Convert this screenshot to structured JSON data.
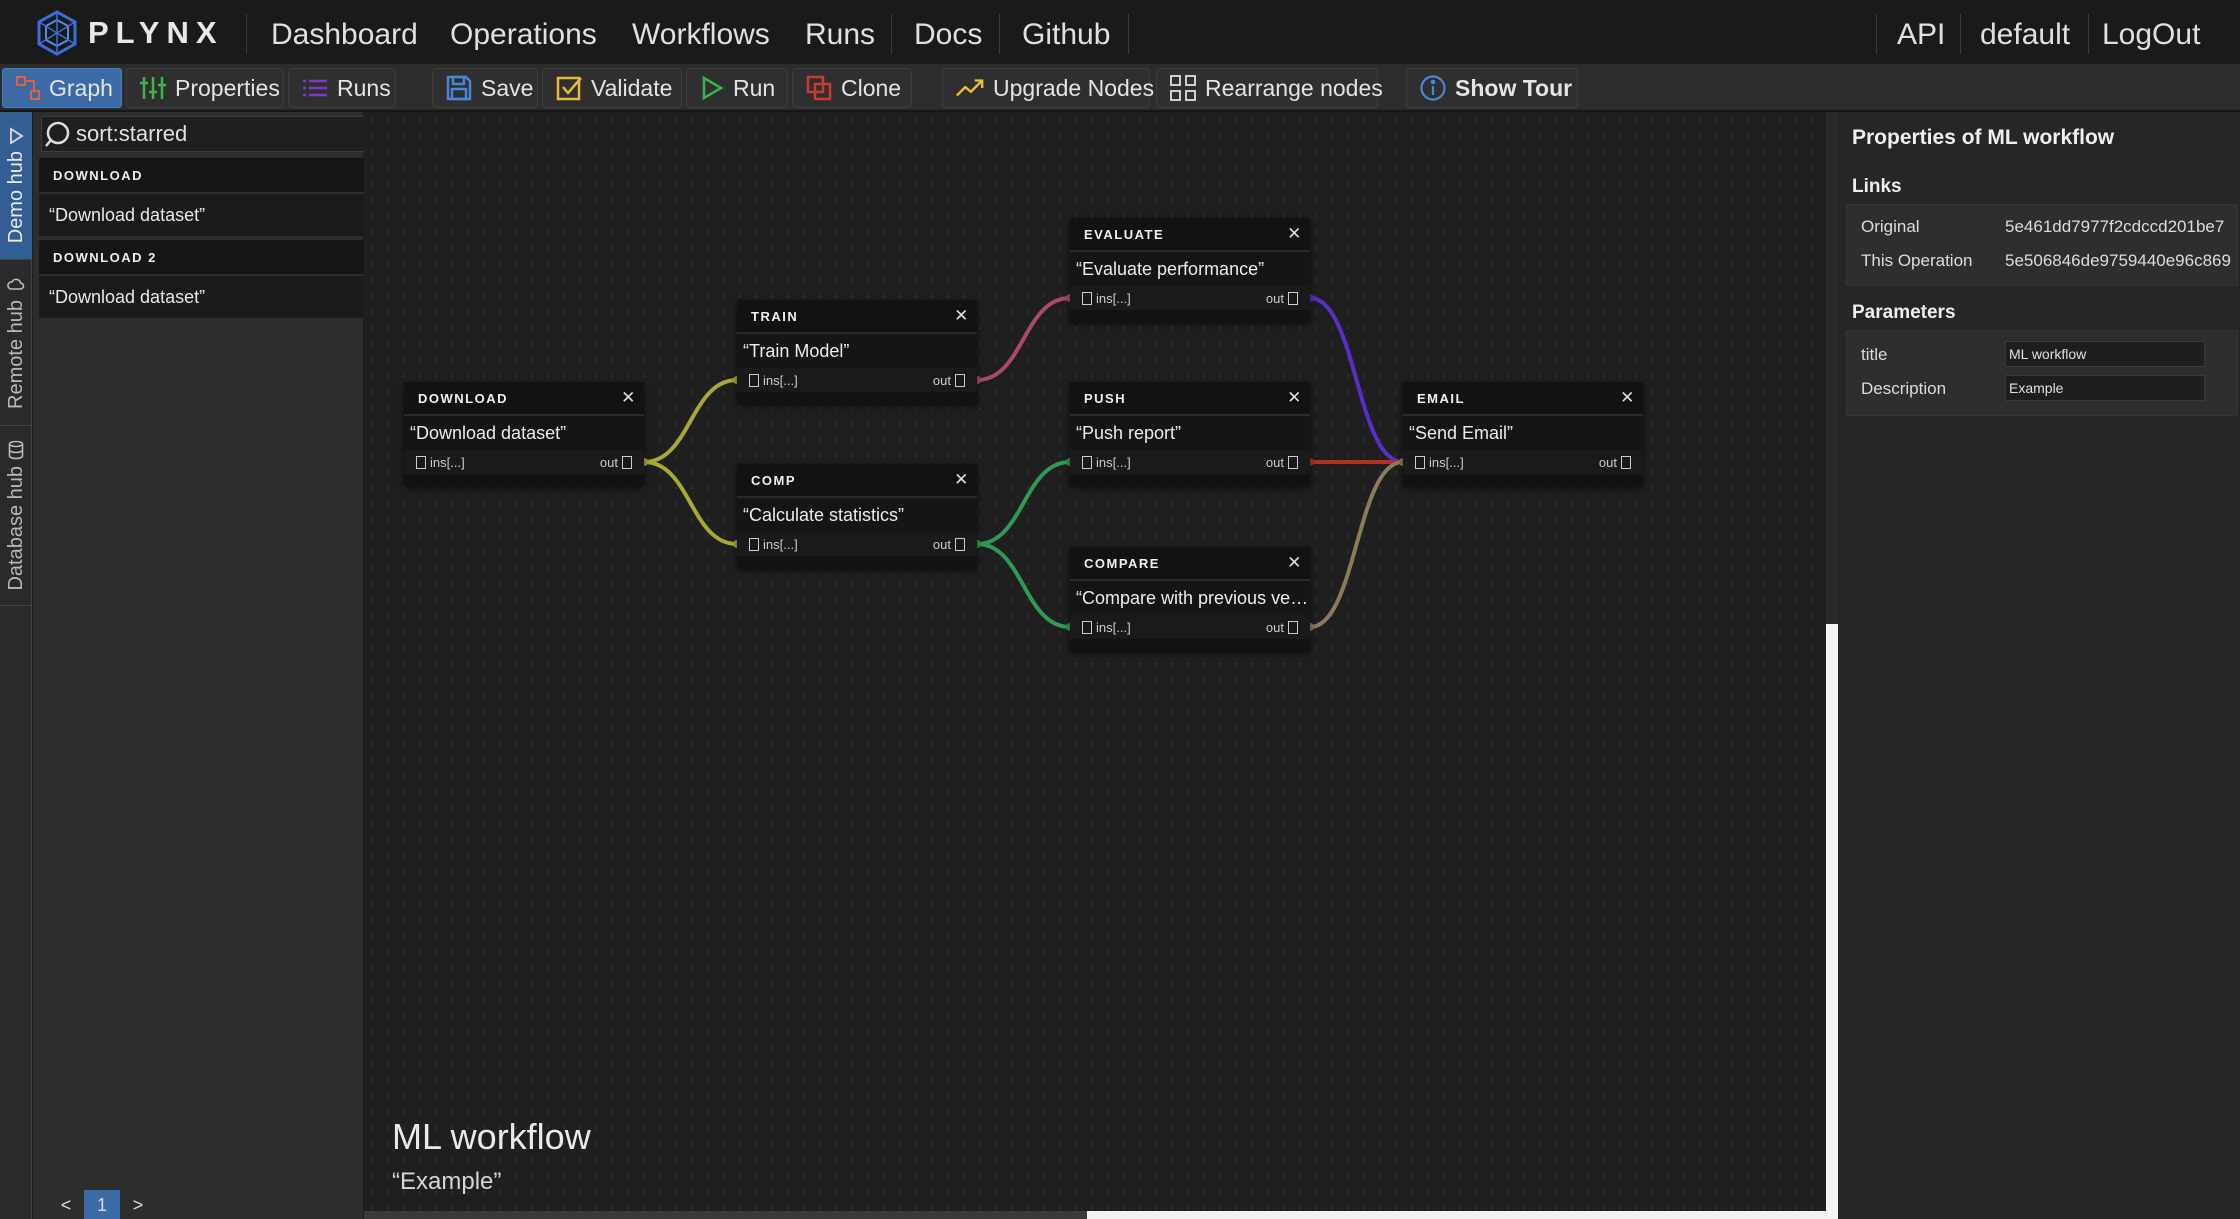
{
  "app": {
    "logo_text": "PLYNX"
  },
  "nav": {
    "left": [
      "Dashboard",
      "Operations",
      "Workflows",
      "Runs",
      "Docs",
      "Github"
    ],
    "right": [
      "API",
      "default",
      "LogOut"
    ]
  },
  "toolbar": {
    "graph": "Graph",
    "properties": "Properties",
    "runs": "Runs",
    "save": "Save",
    "validate": "Validate",
    "run": "Run",
    "clone": "Clone",
    "upgrade": "Upgrade Nodes",
    "rearrange": "Rearrange nodes",
    "tour": "Show Tour"
  },
  "hubs": {
    "demo": "Demo hub",
    "remote": "Remote hub",
    "database": "Database hub"
  },
  "search": {
    "value": "sort:starred"
  },
  "hub_items": [
    {
      "header": "DOWNLOAD",
      "title": "“Download dataset”"
    },
    {
      "header": "DOWNLOAD 2",
      "title": "“Download dataset”"
    }
  ],
  "pager": {
    "prev": "<",
    "current": "1",
    "next": ">"
  },
  "graph": {
    "nodes": [
      {
        "header": "DOWNLOAD",
        "title": "“Download dataset”",
        "in": "ins[...]",
        "out": "out"
      },
      {
        "header": "TRAIN",
        "title": "“Train Model”",
        "in": "ins[...]",
        "out": "out"
      },
      {
        "header": "COMP",
        "title": "“Calculate statistics”",
        "in": "ins[...]",
        "out": "out"
      },
      {
        "header": "EVALUATE",
        "title": "“Evaluate performance”",
        "in": "ins[...]",
        "out": "out"
      },
      {
        "header": "PUSH",
        "title": "“Push report”",
        "in": "ins[...]",
        "out": "out"
      },
      {
        "header": "COMPARE",
        "title": "“Compare with previous ve…",
        "in": "ins[...]",
        "out": "out"
      },
      {
        "header": "EMAIL",
        "title": "“Send Email”",
        "in": "ins[...]",
        "out": "out"
      }
    ],
    "edges": [
      {
        "from": "DOWNLOAD",
        "to": "TRAIN",
        "color": "#a8a832"
      },
      {
        "from": "DOWNLOAD",
        "to": "COMP",
        "color": "#a8a832"
      },
      {
        "from": "TRAIN",
        "to": "EVALUATE",
        "color": "#a84a6a"
      },
      {
        "from": "COMP",
        "to": "PUSH",
        "color": "#2e9a52"
      },
      {
        "from": "COMP",
        "to": "COMPARE",
        "color": "#2e9a52"
      },
      {
        "from": "EVALUATE",
        "to": "EMAIL",
        "color": "#5a2dc4"
      },
      {
        "from": "PUSH",
        "to": "EMAIL",
        "color": "#b03024"
      },
      {
        "from": "COMPARE",
        "to": "EMAIL",
        "color": "#8c7a5a"
      }
    ]
  },
  "workflow": {
    "title": "ML workflow",
    "description": "“Example”"
  },
  "properties": {
    "title": "Properties of ML workflow",
    "links_heading": "Links",
    "links": [
      {
        "label": "Original",
        "value": "5e461dd7977f2cdccd201be7"
      },
      {
        "label": "This Operation",
        "value": "5e506846de9759440e96c869"
      }
    ],
    "params_heading": "Parameters",
    "params": [
      {
        "label": "title",
        "value": "ML workflow"
      },
      {
        "label": "Description",
        "value": "Example"
      }
    ]
  },
  "colors": {
    "accent": "#3b6aa5",
    "background": "#1f1f1f"
  }
}
